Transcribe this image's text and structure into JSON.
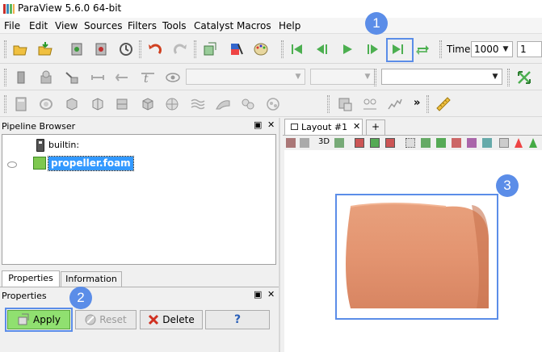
{
  "window": {
    "title": "ParaView 5.6.0 64-bit"
  },
  "menu": [
    "File",
    "Edit",
    "View",
    "Sources",
    "Filters",
    "Tools",
    "Catalyst",
    "Macros",
    "Help"
  ],
  "time": {
    "label": "Time:",
    "value": "1000",
    "step": "1"
  },
  "pipeline_browser": {
    "title": "Pipeline Browser",
    "items": [
      {
        "label": "builtin:"
      },
      {
        "label": "propeller.foam",
        "selected": true
      }
    ]
  },
  "tabs": {
    "properties": "Properties",
    "information": "Information"
  },
  "properties_panel": {
    "title": "Properties",
    "apply_label": "Apply",
    "reset_label": "Reset",
    "delete_label": "Delete",
    "help_label": "?"
  },
  "layout": {
    "tab_label": "Layout #1",
    "close": "✕",
    "add": "+",
    "mode_3d": "3D"
  },
  "dock_controls": {
    "float": "▣",
    "close": "✕"
  },
  "more_toolbar": "»",
  "callouts": [
    "1",
    "2",
    "3"
  ],
  "colors": {
    "accent": "#5b8de8",
    "apply_green": "#90e070",
    "propeller_orange": "#e09470",
    "selection_blue": "#3399ff"
  }
}
